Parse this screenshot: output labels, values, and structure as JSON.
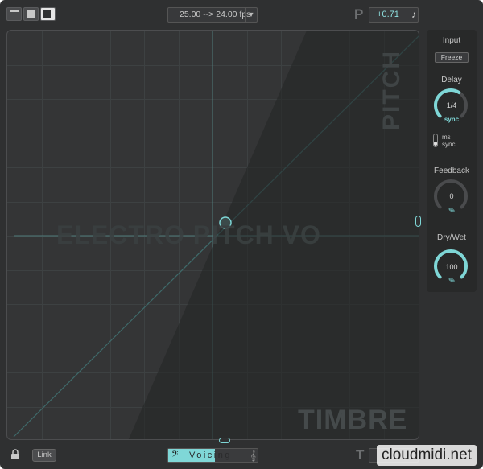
{
  "toolbar": {
    "view_modes": [
      "minimal-view",
      "compact-view",
      "full-view"
    ],
    "fps_label": "25.00 --> 24.00 fps",
    "fps_arrow": "▼",
    "pitch_letter": "P",
    "pitch_value": "+0.71",
    "note_icon": "♪"
  },
  "pad": {
    "pitch_label": "PITCH",
    "timbre_label": "TIMBRE",
    "center_label": "ELECTRO PITCH VO",
    "accent_color": "#7ed6d6"
  },
  "panel": {
    "input_label": "Input",
    "freeze_label": "Freeze",
    "delay_label": "Delay",
    "delay_value": "1/4",
    "delay_unit": "sync",
    "delay_level": 0.62,
    "ms_label": "ms",
    "sync_label": "sync",
    "feedback_label": "Feedback",
    "feedback_value": "0",
    "feedback_unit": "%",
    "feedback_level": 0.0,
    "drywet_label": "Dry/Wet",
    "drywet_value": "100",
    "drywet_unit": "%",
    "drywet_level": 1.0
  },
  "footer": {
    "link_label": "Link",
    "voicing_label": "Voicing",
    "bass_clef": "𝄢",
    "treble_clef": "𝄞",
    "timbre_letter": "T"
  },
  "site_watermark": "cloudmidi.net"
}
